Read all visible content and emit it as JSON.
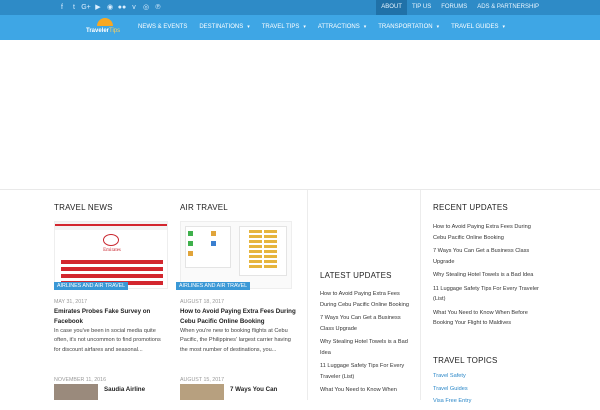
{
  "topbar": {
    "social_icons": [
      "facebook-icon",
      "twitter-icon",
      "google-plus-icon",
      "youtube-icon",
      "rss-icon",
      "flickr-icon",
      "vimeo-icon",
      "instagram-icon",
      "pinterest-icon"
    ],
    "social_glyphs": [
      "f",
      "t",
      "G+",
      "▶",
      "◉",
      "●●",
      "v",
      "◎",
      "℗"
    ],
    "links": [
      "ABOUT",
      "TIP US",
      "FORUMS",
      "ADS & PARTNERSHIP"
    ]
  },
  "logo": {
    "word1": "Traveler",
    "word2": "Tips"
  },
  "nav": {
    "items": [
      {
        "label": "NEWS & EVENTS",
        "caret": ""
      },
      {
        "label": "DESTINATIONS",
        "caret": "▾"
      },
      {
        "label": "TRAVEL TIPS",
        "caret": "▾"
      },
      {
        "label": "ATTRACTIONS",
        "caret": "▾"
      },
      {
        "label": "TRANSPORTATION",
        "caret": "▾"
      },
      {
        "label": "TRAVEL GUIDES",
        "caret": "▾"
      }
    ]
  },
  "travel_news": {
    "title": "TRAVEL NEWS",
    "badge": "AIRLINES AND AIR TRAVEL",
    "post1": {
      "date": "MAY 31, 2017",
      "title": "Emirates Probes Fake Survey on Facebook",
      "excerpt": "In case you've been in social media quite often, it's not uncommon to find promotions for discount airfares and seasonal..."
    },
    "post2": {
      "date": "NOVEMBER 11, 2016",
      "title": "Saudia Airline"
    },
    "thumb_brand": "Emirates"
  },
  "air_travel": {
    "title": "AIR TRAVEL",
    "badge": "AIRLINES AND AIR TRAVEL",
    "post1": {
      "date": "AUGUST 18, 2017",
      "title": "How to Avoid Paying Extra Fees During Cebu Pacific Online Booking",
      "excerpt": "When you're new to booking flights at Cebu Pacific, the Philippines' largest carrier having the most number of destinations, you..."
    },
    "post2": {
      "date": "AUGUST 15, 2017",
      "title": "7 Ways You Can"
    }
  },
  "latest_updates": {
    "title": "LATEST UPDATES",
    "items": [
      "How to Avoid Paying Extra Fees During Cebu Pacific Online Booking",
      "7 Ways You Can Get a Business Class Upgrade",
      "Why Stealing Hotel Towels is a Bad Idea",
      "11 Luggage Safety Tips For Every Traveler (List)",
      "What You Need to Know When"
    ]
  },
  "recent_updates": {
    "title": "RECENT UPDATES",
    "items": [
      "How to Avoid Paying Extra Fees During Cebu Pacific Online Booking",
      "7 Ways You Can Get a Business Class Upgrade",
      "Why Stealing Hotel Towels is a Bad Idea",
      "11 Luggage Safety Tips For Every Traveler (List)",
      "What You Need to Know When Before Booking Your Flight to Maldives"
    ]
  },
  "travel_topics": {
    "title": "TRAVEL TOPICS",
    "items": [
      "Travel Safety",
      "Travel Guides",
      "Visa Free Entry"
    ]
  },
  "colors": {
    "topbar": "#2e8bc7",
    "navbar": "#3ea6e5",
    "accent": "#3a98d6",
    "logo_sun": "#f7a823"
  }
}
